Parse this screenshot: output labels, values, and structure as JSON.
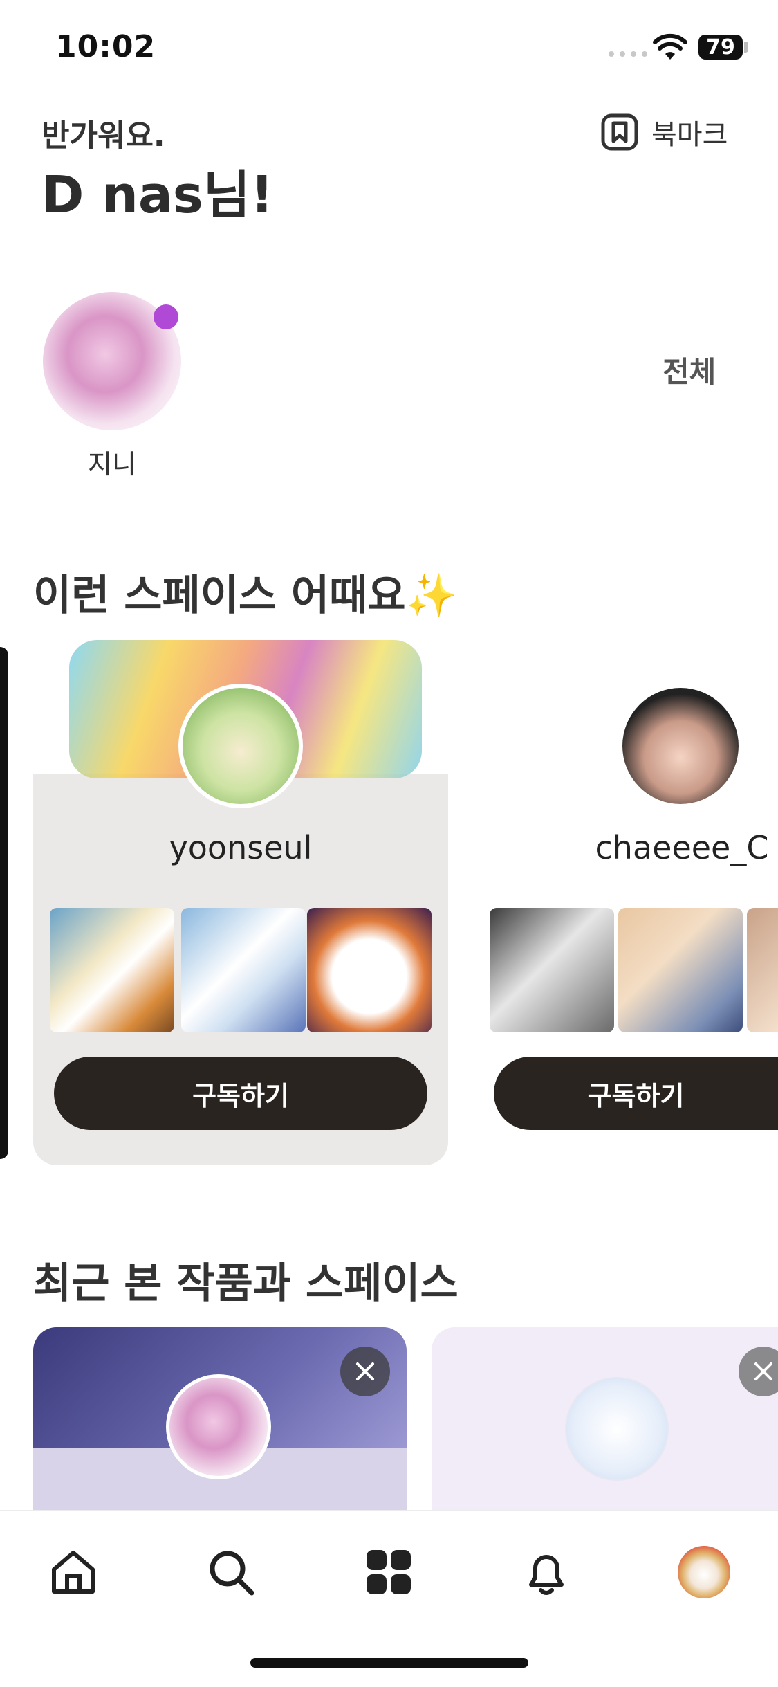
{
  "status_bar": {
    "time": "10:02",
    "battery": "79"
  },
  "greeting": {
    "subtitle": "반가워요.",
    "title": "D nas님!"
  },
  "header": {
    "bookmark_label": "북마크",
    "bookmark_icon": "bookmark-icon"
  },
  "subscriptions": {
    "view_all": "전체",
    "items": [
      {
        "name": "지니",
        "new_indicator_color": "#b04ad6"
      }
    ]
  },
  "recommend": {
    "title": "이런 스페이스 어때요✨",
    "cards": [
      {
        "name": "yoonseul",
        "button": "구독하기"
      },
      {
        "name": "chaeeee_C",
        "button": "구독하기"
      }
    ]
  },
  "recent": {
    "title": "최근 본 작품과 스페이스"
  },
  "nav": {
    "items": [
      {
        "icon": "home-icon"
      },
      {
        "icon": "search-icon"
      },
      {
        "icon": "grid-icon"
      },
      {
        "icon": "bell-icon"
      },
      {
        "icon": "profile-avatar"
      }
    ]
  },
  "colors": {
    "button_dark": "#2a2420",
    "accent_purple": "#b04ad6",
    "card_bg": "#ebe9e8"
  }
}
